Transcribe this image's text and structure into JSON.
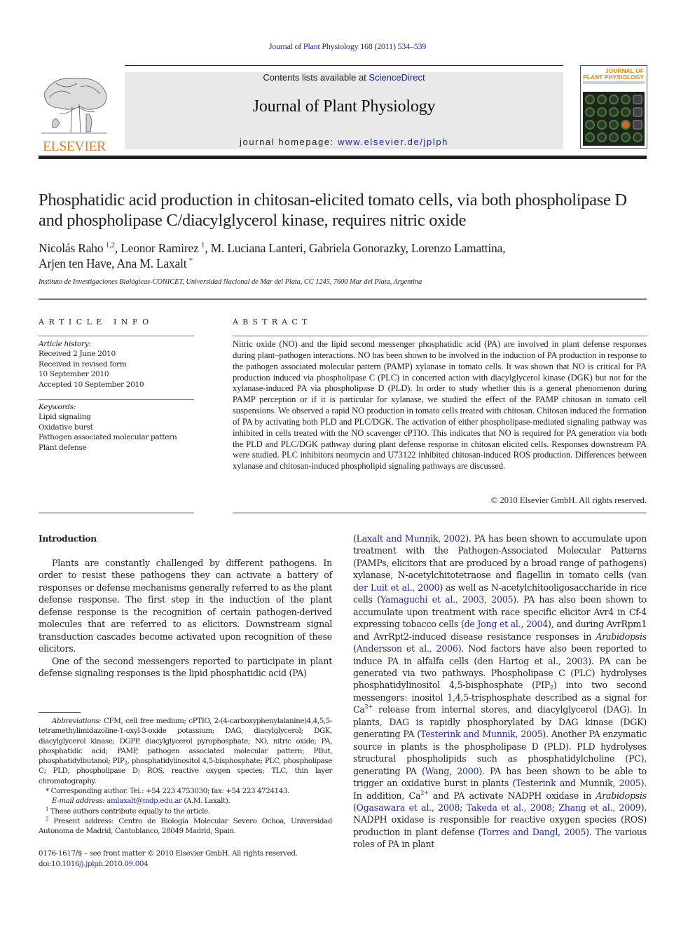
{
  "running_head": "Journal of Plant Physiology 168 (2011) 534–539",
  "masthead": {
    "contents_prefix": "Contents lists available at ",
    "contents_link": "ScienceDirect",
    "journal_title": "Journal of Plant Physiology",
    "homepage_prefix": "journal homepage: ",
    "homepage_link": "www.elsevier.de/jplph",
    "publisher_wordmark": "ELSEVIER",
    "cover_title_line1": "JOURNAL OF",
    "cover_title_line2": "PLANT PHYSIOLOGY"
  },
  "article": {
    "title": "Phosphatidic acid production in chitosan-elicited tomato cells, via both phospholipase D and phospholipase C/diacylglycerol kinase, requires nitric oxide",
    "authors": [
      {
        "name": "Nicolás Raho",
        "marks": "1,2",
        "sep": ", "
      },
      {
        "name": "Leonor Ramirez",
        "marks": "1",
        "sep": ", "
      },
      {
        "name": "M. Luciana Lanteri",
        "marks": "",
        "sep": ", "
      },
      {
        "name": "Gabriela Gonorazky",
        "marks": "",
        "sep": ", "
      },
      {
        "name": "Lorenzo Lamattina",
        "marks": "",
        "sep": ","
      },
      {
        "name": "Arjen ten Have",
        "marks": "",
        "sep": ", "
      },
      {
        "name": "Ana M. Laxalt",
        "marks": "*",
        "sep": ""
      }
    ],
    "affiliation": "Instituto de Investigaciones Biológicas-CONICET, Universidad Nacional de Mar del Plata, CC 1245, 7600 Mar del Plata, Argentina"
  },
  "article_info": {
    "heading": "ARTICLE INFO",
    "history_label": "Article history:",
    "history": [
      "Received 2 June 2010",
      "Received in revised form",
      "10 September 2010",
      "Accepted 10 September 2010"
    ],
    "keywords_label": "Keywords:",
    "keywords": [
      "Lipid signaling",
      "Oxidative burst",
      "Pathogen associated molecular pattern",
      "Plant defense"
    ]
  },
  "abstract": {
    "heading": "ABSTRACT",
    "text": "Nitric oxide (NO) and the lipid second messenger phosphatidic acid (PA) are involved in plant defense responses during plant–pathogen interactions. NO has been shown to be involved in the induction of PA production in response to the pathogen associated molecular pattern (PAMP) xylanase in tomato cells. It was shown that NO is critical for PA production induced via phospholipase C (PLC) in concerted action with diacylglycerol kinase (DGK) but not for the xylanase-induced PA via phospholipase D (PLD). In order to study whether this is a general phenomenon during PAMP perception or if it is particular for xylanase, we studied the effect of the PAMP chitosan in tomato cell suspensions. We observed a rapid NO production in tomato cells treated with chitosan. Chitosan induced the formation of PA by activating both PLD and PLC/DGK. The activation of either phospholipase-mediated signaling pathway was inhibited in cells treated with the NO scavenger cPTIO. This indicates that NO is required for PA generation via both the PLD and PLC/DGK pathway during plant defense response in chitosan elicited cells. Responses downstream PA were studied. PLC inhibitors neomycin and U73122 inhibited chitosan-induced ROS production. Differences between xylanase and chitosan-induced phospholipid signaling pathways are discussed.",
    "copyright": "© 2010 Elsevier GmbH. All rights reserved."
  },
  "introduction": {
    "heading": "Introduction",
    "left_paragraphs": [
      "Plants are constantly challenged by different pathogens. In order to resist these pathogens they can activate a battery of responses or defense mechanisms generally referred to as the plant defense response. The first step in the induction of the plant defense response is the recognition of certain pathogen-derived molecules that are referred to as elicitors. Downstream signal transduction cascades become activated upon recognition of these elicitors.",
      "One of the second messengers reported to participate in plant defense signaling responses is the lipid phosphatidic acid (PA)"
    ],
    "right_segments": [
      {
        "t": "(",
        "k": "text"
      },
      {
        "t": "Laxalt and Munnik, 2002",
        "k": "link"
      },
      {
        "t": "). PA has been shown to accumulate upon treatment with the Pathogen-Associated Molecular Patterns (PAMPs, elicitors that are produced by a broad range of pathogens) xylanase, N-acetylchitotetraose and flagellin in tomato cells (",
        "k": "text"
      },
      {
        "t": "van der Luit et al., 2000",
        "k": "link"
      },
      {
        "t": ") as well as N-acetylchitooligosaccharide in rice cells (",
        "k": "text"
      },
      {
        "t": "Yamaguchi et al., 2003, 2005",
        "k": "link"
      },
      {
        "t": "). PA has also been shown to accumulate upon treatment with race specific elicitor Avr4 in Cf-4 expressing tobacco cells (",
        "k": "text"
      },
      {
        "t": "de Jong et al., 2004",
        "k": "link"
      },
      {
        "t": "), and during AvrRpm1 and AvrRpt2-induced disease resistance responses in ",
        "k": "text"
      },
      {
        "t": "Arabidopsis",
        "k": "italic"
      },
      {
        "t": " (",
        "k": "text"
      },
      {
        "t": "Andersson et al., 2006",
        "k": "link"
      },
      {
        "t": "). Nod factors have also been reported to induce PA in alfalfa cells (",
        "k": "text"
      },
      {
        "t": "den Hartog et al., 2003",
        "k": "link"
      },
      {
        "t": "). PA can be generated via two pathways. Phospholipase C (PLC) hydrolyses phosphatidylinositol 4,5-bisphosphate (PIP",
        "k": "text"
      },
      {
        "t": "2",
        "k": "sub"
      },
      {
        "t": ") into two second messengers: inositol 1,4,5-trisphosphate described as a signal for Ca",
        "k": "text"
      },
      {
        "t": "2+",
        "k": "sup"
      },
      {
        "t": " release from internal stores, and diacylglycerol (DAG). In plants, DAG is rapidly phosphorylated by DAG kinase (DGK) generating PA (",
        "k": "text"
      },
      {
        "t": "Testerink and Munnik, 2005",
        "k": "link"
      },
      {
        "t": "). Another PA enzymatic source in plants is the phospholipase D (PLD). PLD hydrolyses structural phospholipids such as phosphatidylcholine (PC), generating PA (",
        "k": "text"
      },
      {
        "t": "Wang, 2000",
        "k": "link"
      },
      {
        "t": "). PA has been shown to be able to trigger an oxidative burst in plants (",
        "k": "text"
      },
      {
        "t": "Testerink and Munnik, 2005",
        "k": "link"
      },
      {
        "t": "). In addition, Ca",
        "k": "text"
      },
      {
        "t": "2+",
        "k": "sup"
      },
      {
        "t": " and PA activate NADPH oxidase in ",
        "k": "text"
      },
      {
        "t": "Arabidopsis",
        "k": "italic"
      },
      {
        "t": " (",
        "k": "text"
      },
      {
        "t": "Ogasawara et al., 2008; Takeda et al., 2008; Zhang et al., 2009",
        "k": "link"
      },
      {
        "t": "). NADPH oxidase is responsible for reactive oxygen species (ROS) production in plant defense (",
        "k": "text"
      },
      {
        "t": "Torres and Dangl, 2005",
        "k": "link"
      },
      {
        "t": "). The various roles of PA in plant",
        "k": "text"
      }
    ]
  },
  "footnotes": {
    "abbreviations_label": "Abbreviations:",
    "abbreviations_pre": " CFM, cell free medium; cPTIO, 2-(4-carboxyphenylalanine)4,4,5,5-tetramethylimidazoline-1-oxyl-3-oxide potassium; DAG, diacylglycerol; DGK, diacylglycerol kinase; DGPP, diacylglycerol pyrophosphate; NO, nitric oxide; PA, phosphatidic acid; PAMP, pathogen associated molecular pattern; PBut, phosphatidylbutanol; PIP",
    "abbreviations_sub": "2",
    "abbreviations_post": ", phosphatidylinositol 4,5-bisphosphate; PLC, phospholipase C; PLD, phospholipase D; ROS, reactive oxygen species; TLC, thin layer chromatography.",
    "corresponding_mark": "*",
    "corresponding": " Corresponding author. Tel.: +54 223 4753030; fax: +54 223 4724143.",
    "email_label": "E-mail address: ",
    "email": "amlaxalt@mdp.edu.ar",
    "email_suffix": " (A.M. Laxalt).",
    "note1_mark": "1",
    "note1": " These authors contribute equally to the article.",
    "note2_mark": "2",
    "note2": " Present address: Centro de Biología Molecular Severo Ochoa, Universidad Autonoma de Madrid, Cantoblanco, 28049 Madrid, Spain."
  },
  "front_matter": {
    "issn_line": "0176-1617/$ – see front matter © 2010 Elsevier GmbH. All rights reserved.",
    "doi_prefix": "doi:",
    "doi": "10.1016/j.jplph.2010.09.004"
  },
  "colors": {
    "link": "#1f2a8c",
    "elsevier_orange": "#e8782a",
    "masthead_bg": "#e9e9e9",
    "text": "#222222"
  }
}
